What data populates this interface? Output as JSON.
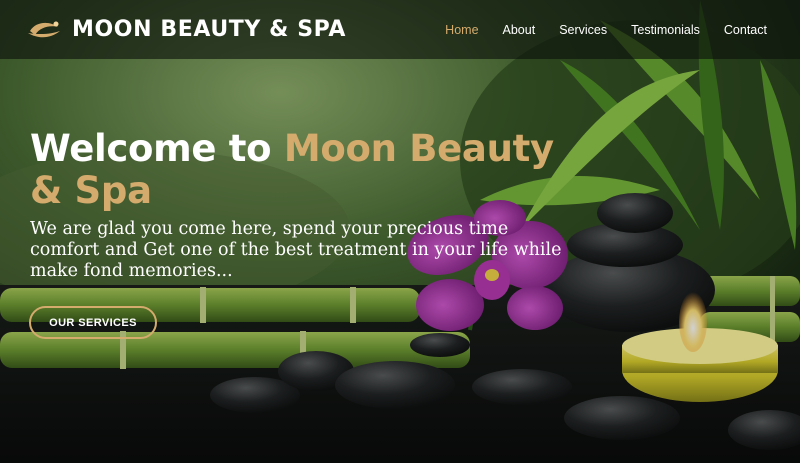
{
  "header": {
    "brand_name": "MOON BEAUTY & SPA",
    "nav": [
      {
        "label": "Home",
        "active": true
      },
      {
        "label": "About",
        "active": false
      },
      {
        "label": "Services",
        "active": false
      },
      {
        "label": "Testimonials",
        "active": false
      },
      {
        "label": "Contact",
        "active": false
      }
    ]
  },
  "hero": {
    "title_plain": "Welcome to ",
    "title_accent": "Moon Beauty & Spa",
    "text": "We are glad you come here, spend your precious time comfort and Get one of the best treatment in your life while make fond memories...",
    "cta_label": "OUR SERVICES"
  },
  "colors": {
    "accent": "#d4ab6d",
    "nav_background": "#0c100c",
    "text": "#ffffff"
  },
  "icons": {
    "brand_logo": "crescent-moon-logo-icon"
  }
}
